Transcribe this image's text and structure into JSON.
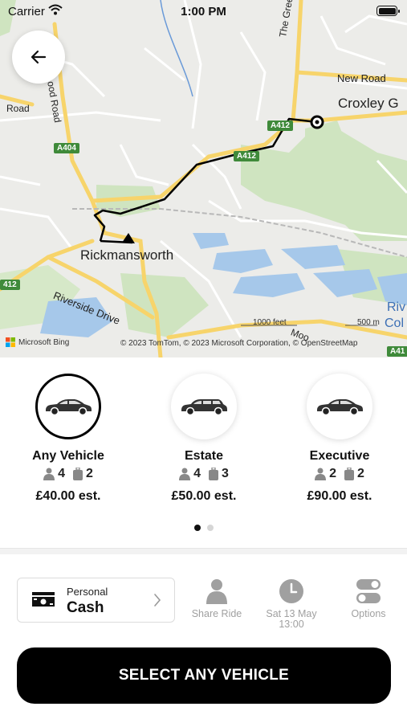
{
  "status_bar": {
    "carrier": "Carrier",
    "time": "1:00 PM"
  },
  "map": {
    "place_labels": {
      "rickmansworth": "Rickmansworth",
      "croxley": "Croxley G",
      "river_col_1": "Riv",
      "river_col_2": "Col",
      "new_road": "New Road",
      "the_green": "The Green",
      "riverside_drive": "Riverside Drive",
      "wood_road": "ood Road",
      "x_road": "Road",
      "moor": "Moo"
    },
    "road_shields": {
      "a404": "A404",
      "a412_top": "A412",
      "a412_mid": "A412",
      "a412_left": "412",
      "a41": "A41"
    },
    "scale": {
      "feet": "1000 feet",
      "meters": "500 m"
    },
    "attribution": {
      "bing": "Microsoft Bing",
      "copyright": "© 2023 TomTom, © 2023 Microsoft Corporation, © OpenStreetMap"
    }
  },
  "vehicles": [
    {
      "name": "Any Vehicle",
      "passengers": "4",
      "luggage": "2",
      "price": "£40.00 est.",
      "selected": true
    },
    {
      "name": "Estate",
      "passengers": "4",
      "luggage": "3",
      "price": "£50.00 est.",
      "selected": false
    },
    {
      "name": "Executive",
      "passengers": "2",
      "luggage": "2",
      "price": "£90.00 est.",
      "selected": false
    }
  ],
  "pager": {
    "pages": 2,
    "active": 1
  },
  "payment": {
    "type": "Personal",
    "method": "Cash"
  },
  "options": {
    "share_ride": "Share Ride",
    "date": "Sat 13 May",
    "time": "13:00",
    "options": "Options"
  },
  "primary_action": "SELECT ANY VEHICLE",
  "colors": {
    "primary": "#000000",
    "route": "#000000",
    "road_major": "#f7d46b",
    "water": "#a6c8ea",
    "park": "#cfe4c0"
  },
  "icons": [
    "back-arrow-icon",
    "wifi-icon",
    "battery-icon",
    "car-icon",
    "person-icon",
    "luggage-icon",
    "cash-icon",
    "chevron-right-icon",
    "share-ride-icon",
    "clock-icon",
    "toggle-options-icon",
    "microsoft-logo"
  ]
}
